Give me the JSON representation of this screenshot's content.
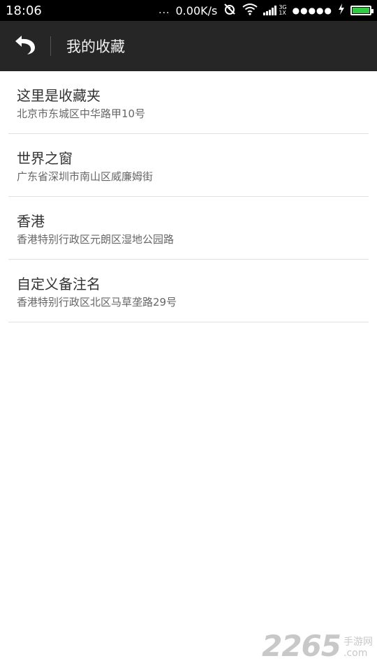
{
  "status_bar": {
    "time": "18:06",
    "more": "...",
    "net_speed": "0.00K/s",
    "network_type_top": "3G",
    "network_type_bottom": "1X",
    "signal_dots": "●●●●●"
  },
  "app_bar": {
    "title": "我的收藏"
  },
  "favorites": [
    {
      "name": "这里是收藏夹",
      "address": "北京市东城区中华路甲10号"
    },
    {
      "name": "世界之窗",
      "address": "广东省深圳市南山区威廉姆街"
    },
    {
      "name": "香港",
      "address": "香港特别行政区元朗区湿地公园路"
    },
    {
      "name": "自定义备注名",
      "address": "香港特别行政区北区马草垄路29号"
    }
  ],
  "watermark": {
    "number": "2265",
    "cn": "手游网",
    "domain": ".com"
  },
  "colors": {
    "status_bar_bg": "#000000",
    "app_bar_bg": "#262626",
    "battery_fill": "#2ecc40"
  },
  "icons": {
    "back": "back-arrow-icon",
    "alarm_off": "alarm-off-icon",
    "wifi": "wifi-icon",
    "charging": "charging-bolt-icon",
    "battery": "battery-icon"
  }
}
